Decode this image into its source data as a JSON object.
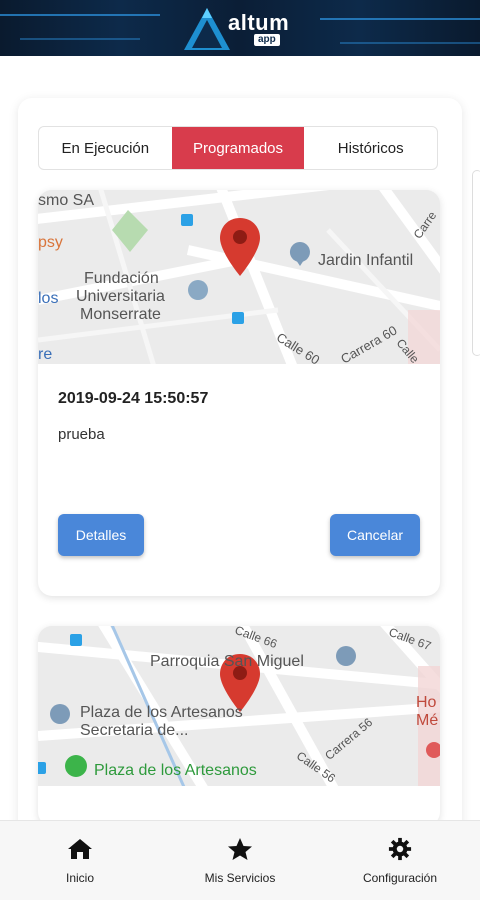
{
  "header": {
    "logo_text": "altum",
    "logo_sub": "app"
  },
  "tabs": [
    {
      "label": "En Ejecución",
      "active": false
    },
    {
      "label": "Programados",
      "active": true
    },
    {
      "label": "Históricos",
      "active": false
    }
  ],
  "cards": [
    {
      "map_labels": {
        "l1": "smo SA",
        "l2": "psy",
        "l3": "Fundación",
        "l4": "Universitaria",
        "l5": "Monserrate",
        "l6": "los",
        "l7": "Jardin Infantil",
        "l8": "Calle 60",
        "l9": "Carrera 60",
        "l10": "Carre",
        "l11": "Calle",
        "l12": "re"
      },
      "date": "2019-09-24 15:50:57",
      "description": "prueba",
      "details_label": "Detalles",
      "cancel_label": "Cancelar"
    },
    {
      "map_labels": {
        "l1": "Parroquia San Miguel",
        "l2": "Plaza de los Artesanos",
        "l3": "Secretaria de...",
        "l4": "Plaza de los Artesanos",
        "l5": "Carrera 56",
        "l6": "Calle 56",
        "l7": "Calle 66",
        "l8": "Calle 67",
        "l9": "Ho",
        "l10": "Mé"
      }
    }
  ],
  "bottom_nav": [
    {
      "label": "Inicio",
      "icon": "home-icon"
    },
    {
      "label": "Mis Servicios",
      "icon": "star-icon"
    },
    {
      "label": "Configuración",
      "icon": "gear-icon"
    }
  ],
  "colors": {
    "accent_red": "#d83c4c",
    "button_blue": "#4a87d9",
    "pin_red": "#d63a2f"
  }
}
